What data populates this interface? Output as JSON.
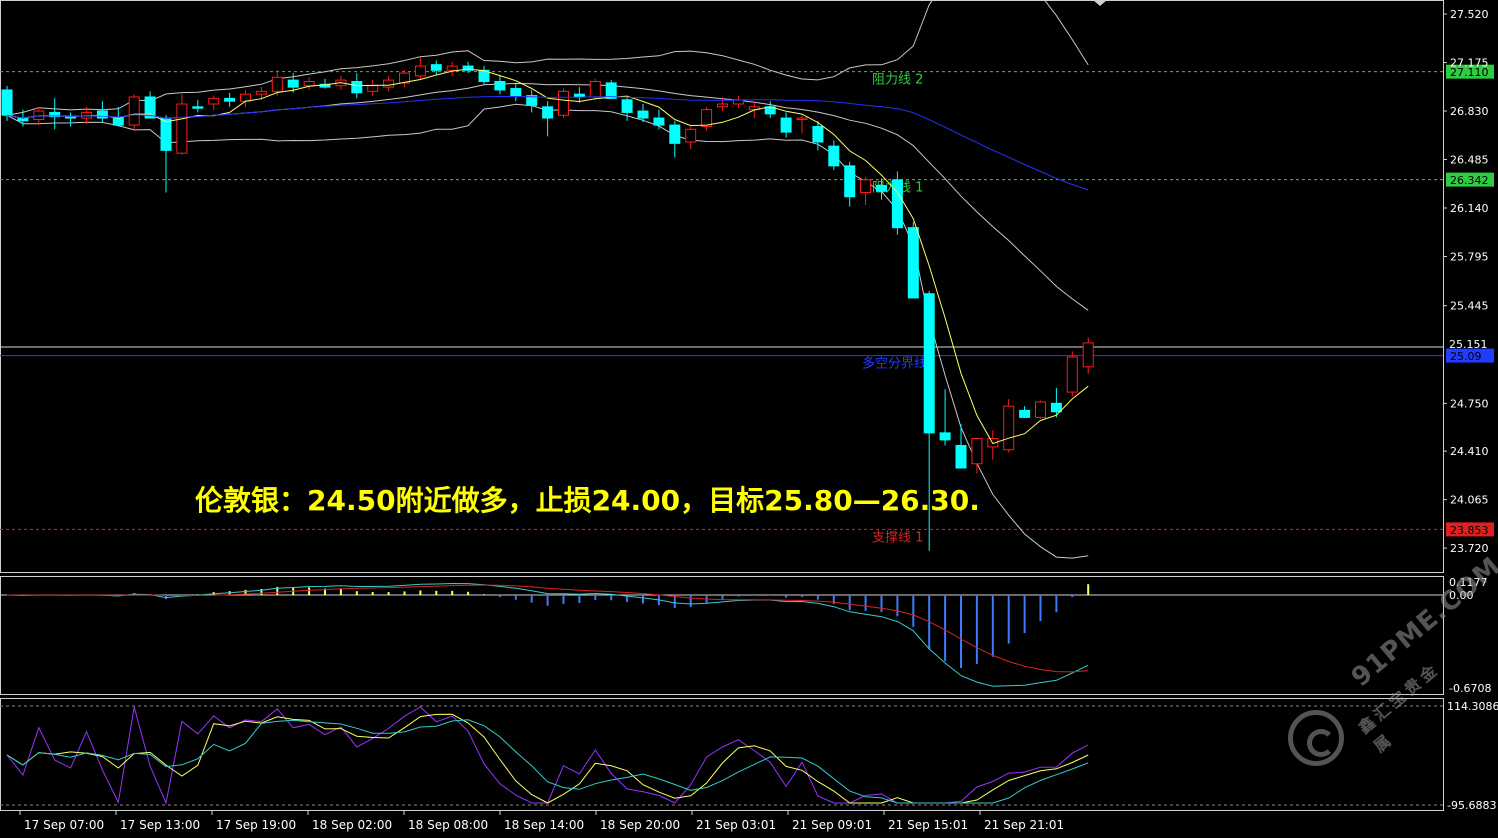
{
  "chart_data": [
    {
      "type": "candlestick",
      "title": "伦敦银：24.50附近做多，止损24.00，目标25.80—26.30.",
      "ylim": [
        23.55,
        27.62
      ],
      "y_ticks": [
        "27.520",
        "27.175",
        "26.830",
        "26.485",
        "26.140",
        "25.795",
        "25.445",
        "24.750",
        "24.410",
        "24.065",
        "23.720"
      ],
      "x_ticks": [
        "17 Sep 07:00",
        "17 Sep 13:00",
        "17 Sep 19:00",
        "18 Sep 02:00",
        "18 Sep 08:00",
        "18 Sep 14:00",
        "18 Sep 20:00",
        "21 Sep 03:01",
        "21 Sep 09:01",
        "21 Sep 15:01",
        "21 Sep 21:01"
      ],
      "hlines": [
        {
          "name": "阻力线 2",
          "value": 27.11,
          "label": "27.110",
          "color": "#2ecc40",
          "style": "dashed"
        },
        {
          "name": "阻力线 1",
          "value": 26.342,
          "label": "26.342",
          "color": "#2ecc40",
          "style": "dashed"
        },
        {
          "name": "多空分界线",
          "value": 25.09,
          "label": "25.09",
          "color": "#1f3cff",
          "style": "solid"
        },
        {
          "name": "支撑线 1",
          "value": 23.853,
          "label": "23.853",
          "color": "#e02020",
          "style": "dashed"
        }
      ],
      "current_price": {
        "value": 25.151,
        "label": "25.151"
      },
      "candles": [
        [
          26.98,
          27.01,
          26.76,
          26.8
        ],
        [
          26.78,
          26.84,
          26.72,
          26.76
        ],
        [
          26.77,
          26.86,
          26.73,
          26.83
        ],
        [
          26.82,
          26.92,
          26.7,
          26.79
        ],
        [
          26.79,
          26.82,
          26.72,
          26.78
        ],
        [
          26.78,
          26.86,
          26.74,
          26.82
        ],
        [
          26.83,
          26.9,
          26.75,
          26.78
        ],
        [
          26.78,
          26.86,
          26.72,
          26.73
        ],
        [
          26.73,
          26.95,
          26.7,
          26.93
        ],
        [
          26.93,
          26.97,
          26.78,
          26.78
        ],
        [
          26.78,
          26.8,
          26.25,
          26.55
        ],
        [
          26.53,
          26.95,
          26.52,
          26.88
        ],
        [
          26.86,
          26.91,
          26.82,
          26.85
        ],
        [
          26.88,
          26.94,
          26.84,
          26.92
        ],
        [
          26.92,
          26.96,
          26.86,
          26.9
        ],
        [
          26.9,
          26.98,
          26.86,
          26.95
        ],
        [
          26.95,
          27.0,
          26.91,
          26.97
        ],
        [
          26.97,
          27.12,
          26.94,
          27.07
        ],
        [
          27.05,
          27.1,
          26.96,
          27.0
        ],
        [
          27.01,
          27.07,
          26.98,
          27.04
        ],
        [
          27.02,
          27.06,
          26.99,
          27.0
        ],
        [
          27.01,
          27.08,
          26.98,
          27.05
        ],
        [
          27.04,
          27.1,
          26.92,
          26.96
        ],
        [
          26.97,
          27.05,
          26.94,
          27.01
        ],
        [
          27.0,
          27.08,
          26.97,
          27.05
        ],
        [
          27.03,
          27.12,
          27.0,
          27.1
        ],
        [
          27.08,
          27.21,
          27.05,
          27.15
        ],
        [
          27.16,
          27.19,
          27.09,
          27.12
        ],
        [
          27.12,
          27.18,
          27.08,
          27.15
        ],
        [
          27.15,
          27.18,
          27.1,
          27.12
        ],
        [
          27.12,
          27.15,
          27.02,
          27.04
        ],
        [
          27.04,
          27.08,
          26.95,
          26.98
        ],
        [
          26.99,
          27.02,
          26.9,
          26.94
        ],
        [
          26.94,
          26.98,
          26.82,
          26.87
        ],
        [
          26.86,
          26.9,
          26.65,
          26.78
        ],
        [
          26.8,
          26.99,
          26.78,
          26.97
        ],
        [
          26.95,
          27.0,
          26.89,
          26.93
        ],
        [
          26.93,
          27.06,
          26.91,
          27.04
        ],
        [
          27.03,
          27.05,
          26.92,
          26.92
        ],
        [
          26.91,
          26.93,
          26.76,
          26.82
        ],
        [
          26.83,
          26.88,
          26.75,
          26.78
        ],
        [
          26.78,
          26.84,
          26.7,
          26.73
        ],
        [
          26.73,
          26.76,
          26.5,
          26.6
        ],
        [
          26.61,
          26.72,
          26.56,
          26.7
        ],
        [
          26.72,
          26.86,
          26.69,
          26.84
        ],
        [
          26.86,
          26.93,
          26.83,
          26.88
        ],
        [
          26.88,
          26.94,
          26.85,
          26.91
        ],
        [
          26.84,
          26.9,
          26.78,
          26.86
        ],
        [
          26.86,
          26.9,
          26.78,
          26.81
        ],
        [
          26.78,
          26.82,
          26.64,
          26.68
        ],
        [
          26.77,
          26.8,
          26.67,
          26.78
        ],
        [
          26.72,
          26.76,
          26.55,
          26.61
        ],
        [
          26.58,
          26.62,
          26.41,
          26.44
        ],
        [
          26.44,
          26.47,
          26.15,
          26.22
        ],
        [
          26.25,
          26.36,
          26.16,
          26.34
        ],
        [
          26.3,
          26.35,
          26.2,
          26.26
        ],
        [
          26.34,
          26.4,
          25.95,
          26.0
        ],
        [
          26.0,
          26.04,
          25.5,
          25.5
        ],
        [
          25.53,
          25.55,
          23.7,
          24.54
        ],
        [
          24.54,
          24.85,
          24.45,
          24.49
        ],
        [
          24.45,
          24.6,
          24.29,
          24.29
        ],
        [
          24.32,
          24.48,
          24.25,
          24.5
        ],
        [
          24.44,
          24.56,
          24.35,
          24.5
        ],
        [
          24.42,
          24.78,
          24.4,
          24.73
        ],
        [
          24.7,
          24.73,
          24.65,
          24.65
        ],
        [
          24.65,
          24.77,
          24.64,
          24.76
        ],
        [
          24.75,
          24.86,
          24.65,
          24.69
        ],
        [
          24.83,
          25.12,
          24.8,
          25.08
        ],
        [
          25.01,
          25.22,
          24.96,
          25.18
        ]
      ]
    },
    {
      "type": "bar-line",
      "name": "MACD",
      "y_ticks": [
        "0.1177",
        "0.00",
        "-0.6708"
      ]
    },
    {
      "type": "line",
      "name": "oscillator",
      "y_ticks": [
        "114.3086",
        "-95.6883"
      ]
    }
  ],
  "watermark": {
    "text": "91PME.COM",
    "sub": "鑫汇宝贵金属"
  },
  "colors": {
    "up": "#ff1a1a",
    "down": "#00ffff",
    "ma_fast": "#ffff66",
    "ma_slow": "#2233ff",
    "band": "#c8c8c8",
    "title": "#ffff00"
  }
}
